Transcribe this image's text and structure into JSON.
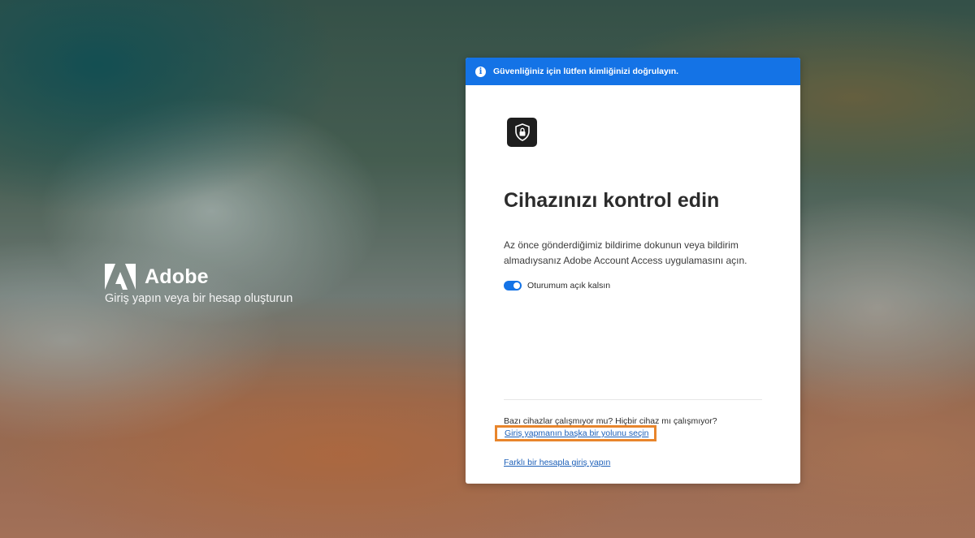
{
  "brand": {
    "name": "Adobe",
    "tagline": "Giriş yapın veya bir hesap oluşturun"
  },
  "banner": {
    "text": "Güvenliğiniz için lütfen kimliğinizi doğrulayın.",
    "icon": "info-icon"
  },
  "card": {
    "app_icon": "shield-lock-icon",
    "title": "Cihazınızı kontrol edin",
    "description": "Az önce gönderdiğimiz bildirime dokunun veya bildirim almadıysanız Adobe Account Access uygulamasını açın.",
    "stay_signed_in": {
      "label": "Oturumum açık kalsın",
      "checked": true
    },
    "question": "Bazı cihazlar çalışmıyor mu? Hiçbir cihaz mı çalışmıyor?",
    "alt_signin_link": "Giriş yapmanın başka bir yolunu seçin",
    "other_account_link": "Farklı bir hesapla giriş yapın"
  },
  "colors": {
    "accent": "#1473e6",
    "highlight": "#e8852b",
    "link": "#1c5fb8"
  }
}
